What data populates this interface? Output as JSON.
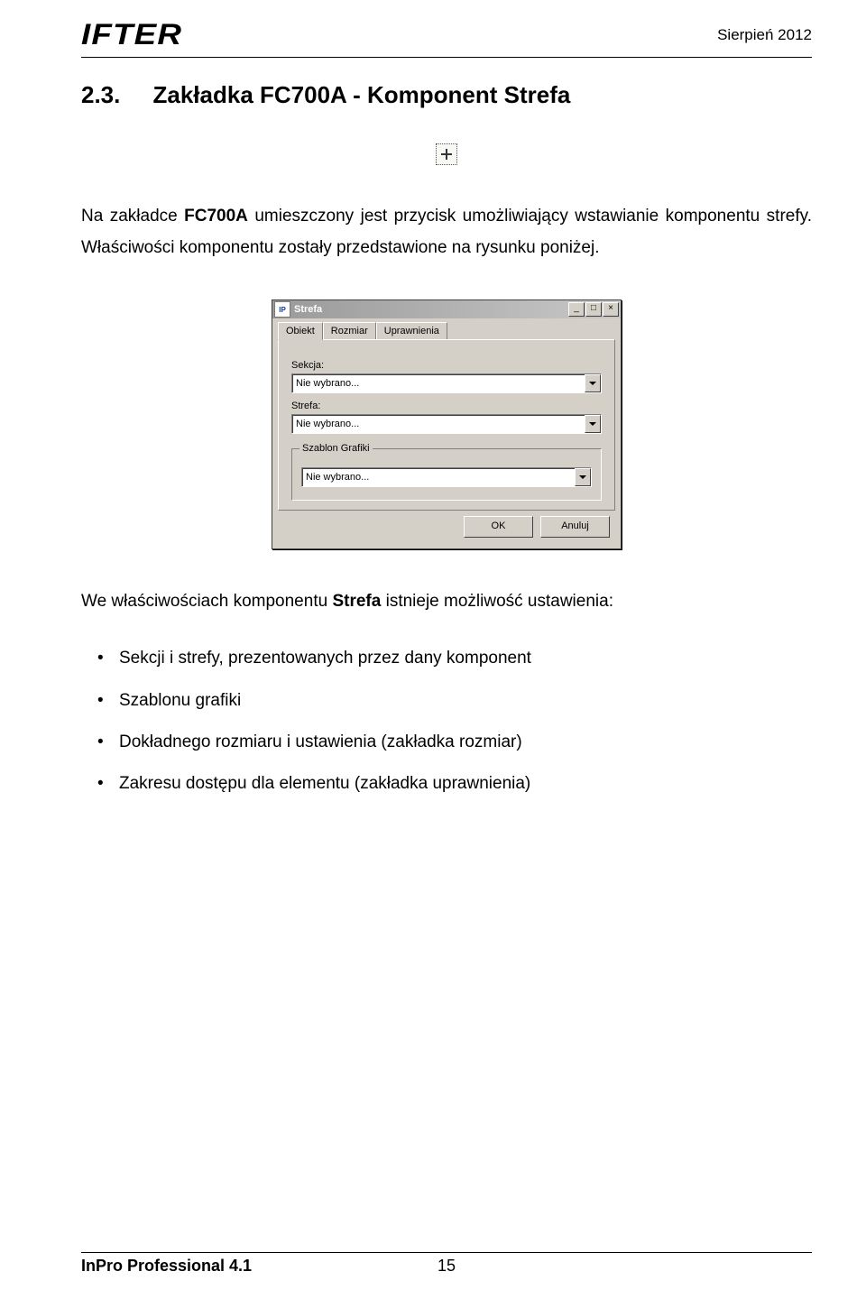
{
  "header": {
    "logo_text": "IFTER",
    "date_text": "Sierpień 2012"
  },
  "section": {
    "number": "2.3.",
    "title": "Zakładka  FC700A  - Komponent Strefa"
  },
  "intro": {
    "line1_pre": "Na zakładce ",
    "line1_bold": "FC700A",
    "line1_post": " umieszczony jest przycisk umożliwiający wstawianie komponentu strefy. Właściwości komponentu zostały przedstawione na rysunku poniżej."
  },
  "dialog": {
    "title": "Strefa",
    "tabs": [
      "Obiekt",
      "Rozmiar",
      "Uprawnienia"
    ],
    "labels": {
      "sekcja": "Sekcja:",
      "strefa": "Strefa:",
      "szablon": "Szablon Grafiki"
    },
    "dropdown_value": "Nie wybrano...",
    "buttons": {
      "ok": "OK",
      "cancel": "Anuluj"
    }
  },
  "settings": {
    "intro_pre": "We właściwościach komponentu ",
    "intro_bold": "Strefa",
    "intro_post": "  istnieje możliwość ustawienia:",
    "items": [
      "Sekcji i strefy, prezentowanych przez dany komponent",
      "Szablonu grafiki",
      "Dokładnego rozmiaru i ustawienia (zakładka rozmiar)",
      "Zakresu dostępu dla elementu (zakładka uprawnienia)"
    ]
  },
  "footer": {
    "left": "InPro Professional 4.1",
    "page": "15"
  }
}
